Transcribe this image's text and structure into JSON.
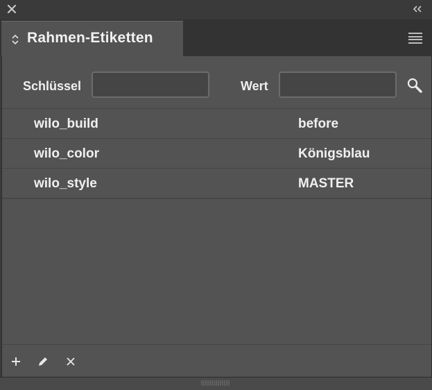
{
  "panel": {
    "title": "Rahmen-Etiketten"
  },
  "filter": {
    "key_label": "Schlüssel",
    "key_value": "",
    "value_label": "Wert",
    "value_value": ""
  },
  "rows": [
    {
      "key": "wilo_build",
      "value": "before"
    },
    {
      "key": "wilo_color",
      "value": "Königsblau"
    },
    {
      "key": "wilo_style",
      "value": "MASTER"
    }
  ],
  "icons": {
    "close": "close-icon",
    "collapse": "double-chevron-left-icon",
    "sort": "up-down-arrows-icon",
    "menu": "hamburger-menu-icon",
    "search": "magnifier-icon",
    "add": "plus-icon",
    "edit": "pencil-icon",
    "delete": "x-icon"
  },
  "colors": {
    "panel_bg": "#535353",
    "chrome_bg": "#3a3a3a",
    "text": "#f0f0f0"
  }
}
